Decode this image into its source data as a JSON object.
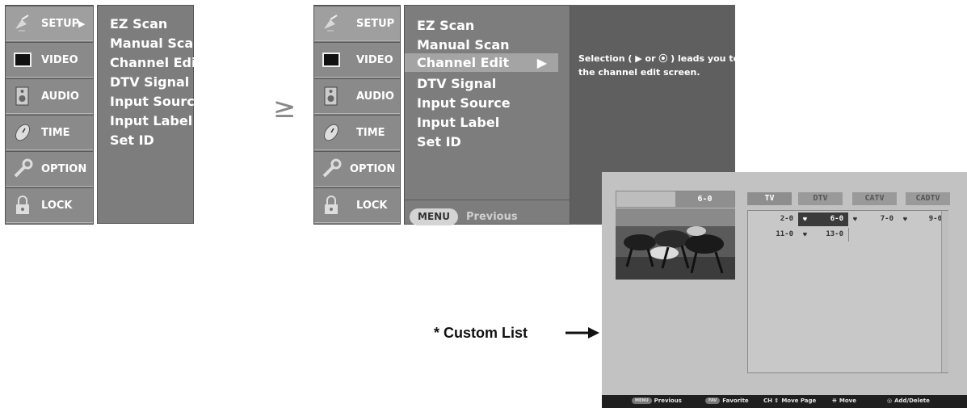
{
  "menu_a": {
    "sidebar": [
      {
        "label": "SETUP",
        "icon": "satellite-dish-icon",
        "arrow": "▶"
      },
      {
        "label": "VIDEO",
        "icon": "monitor-icon"
      },
      {
        "label": "AUDIO",
        "icon": "speaker-icon"
      },
      {
        "label": "TIME",
        "icon": "clock-icon"
      },
      {
        "label": "OPTION",
        "icon": "wrench-icon"
      },
      {
        "label": "LOCK",
        "icon": "padlock-icon"
      }
    ],
    "items": [
      "EZ Scan",
      "Manual Scan",
      "Channel Edit",
      "DTV Signal",
      "Input Source",
      "Input Label",
      "Set ID"
    ]
  },
  "transition_symbol": "≥",
  "menu_b": {
    "sidebar": [
      {
        "label": "SETUP",
        "icon": "satellite-dish-icon"
      },
      {
        "label": "VIDEO",
        "icon": "monitor-icon"
      },
      {
        "label": "AUDIO",
        "icon": "speaker-icon"
      },
      {
        "label": "TIME",
        "icon": "clock-icon"
      },
      {
        "label": "OPTION",
        "icon": "wrench-icon"
      },
      {
        "label": "LOCK",
        "icon": "padlock-icon"
      }
    ],
    "items": [
      "EZ Scan",
      "Manual Scan",
      "Channel Edit",
      "DTV Signal",
      "Input Source",
      "Input Label",
      "Set ID"
    ],
    "selected_arrow": "▶",
    "menu_button": "MENU",
    "previous": "Previous",
    "help": "Selection ( ▶ or ⦿ ) leads you to the channel edit screen."
  },
  "callout": "* Custom List",
  "channel_edit": {
    "preview_channel": "6-0",
    "tabs": [
      "TV",
      "DTV",
      "CATV",
      "CADTV"
    ],
    "rows": [
      [
        {
          "ch": "2-0",
          "fav": false,
          "sel": false
        },
        {
          "ch": "6-0",
          "fav": true,
          "sel": true
        },
        {
          "ch": "7-0",
          "fav": true,
          "sel": false
        },
        {
          "ch": "9-0",
          "fav": true,
          "sel": false
        }
      ],
      [
        {
          "ch": "11-0",
          "fav": false,
          "sel": false
        },
        {
          "ch": "13-0",
          "fav": true,
          "sel": false
        }
      ]
    ],
    "heart": "♥",
    "footer": {
      "previous_key": "MENU",
      "previous": "Previous",
      "favorite_key": "FAV",
      "favorite": "Favorite",
      "page_key": "CH ⇕",
      "page": "Move Page",
      "move_key": "⁜",
      "move": "Move",
      "add_key": "◎",
      "add": "Add/Delete"
    }
  }
}
